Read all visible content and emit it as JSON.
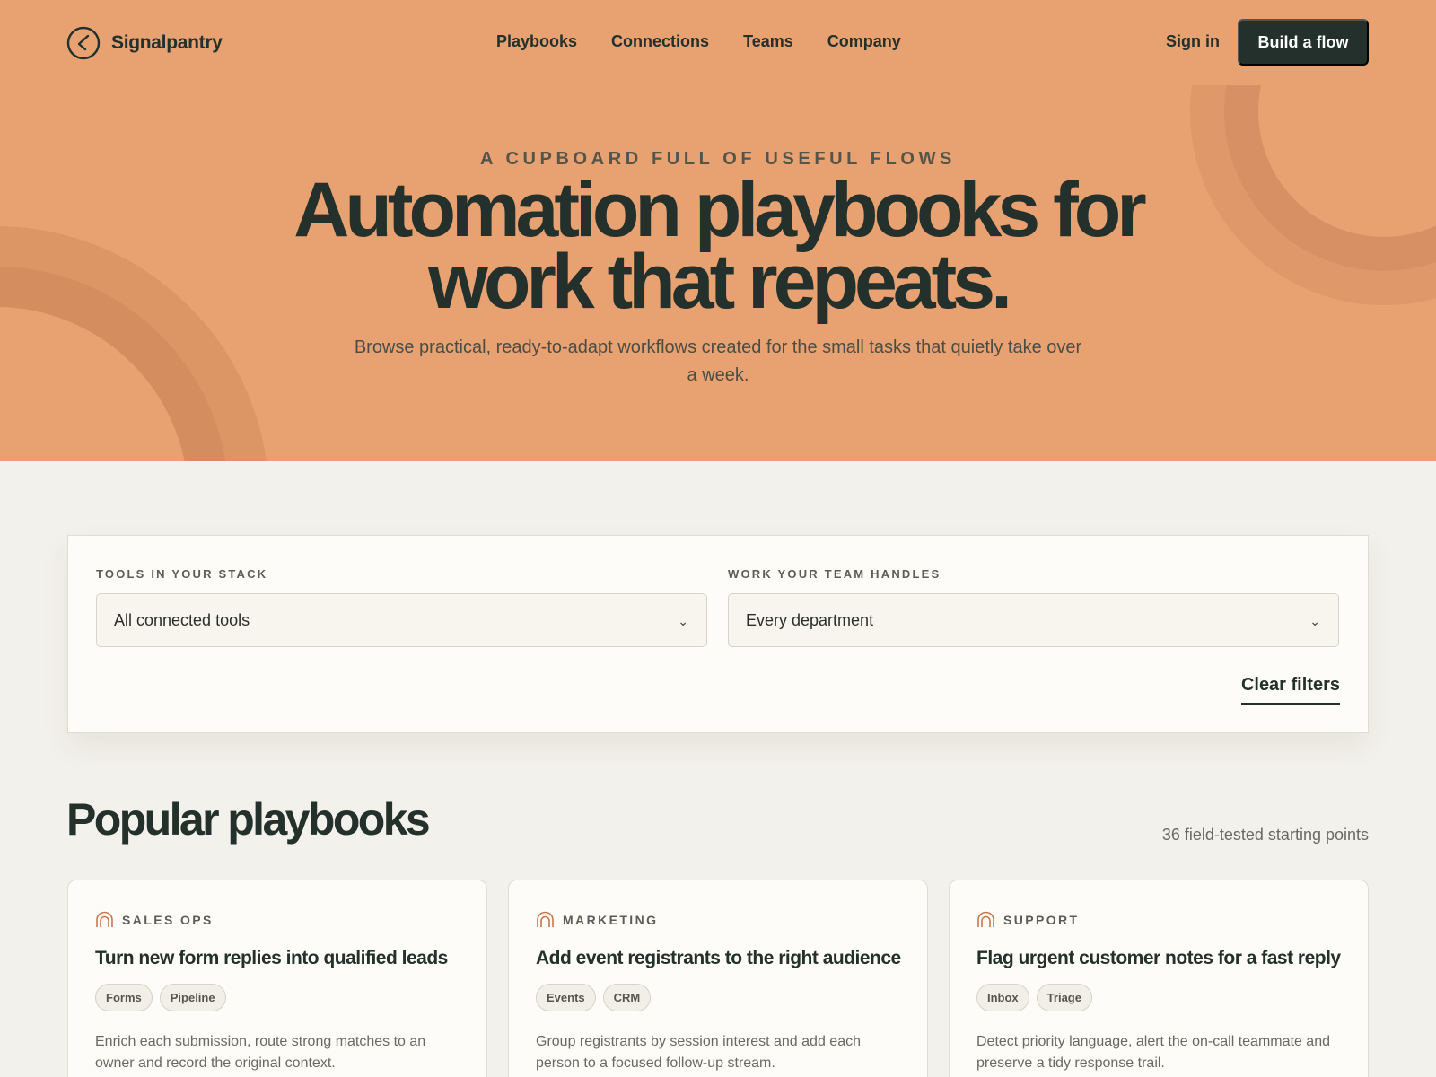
{
  "brand": {
    "name": "Signalpantry"
  },
  "nav": {
    "links": [
      {
        "label": "Playbooks"
      },
      {
        "label": "Connections"
      },
      {
        "label": "Teams"
      },
      {
        "label": "Company"
      }
    ],
    "sign_in": "Sign in",
    "cta": "Build a flow"
  },
  "hero": {
    "eyebrow": "A CUPBOARD FULL OF USEFUL FLOWS",
    "headline_line1": "Automation playbooks for",
    "headline_line2": "work that repeats.",
    "subline": "Browse practical, ready-to-adapt workflows created for the small tasks that quietly take over a week."
  },
  "filters": {
    "tools": {
      "label": "TOOLS IN YOUR STACK",
      "value": "All connected tools"
    },
    "department": {
      "label": "WORK YOUR TEAM HANDLES",
      "value": "Every department"
    },
    "clear": "Clear filters"
  },
  "section": {
    "title": "Popular playbooks",
    "count": "36 field-tested starting points"
  },
  "cards": [
    {
      "category": "SALES OPS",
      "title": "Turn new form replies into qualified leads",
      "tags": [
        "Forms",
        "Pipeline"
      ],
      "description": "Enrich each submission, route strong matches to an owner and record the original context."
    },
    {
      "category": "MARKETING",
      "title": "Add event registrants to the right audience",
      "tags": [
        "Events",
        "CRM"
      ],
      "description": "Group registrants by session interest and add each person to a focused follow-up stream."
    },
    {
      "category": "SUPPORT",
      "title": "Flag urgent customer notes for a fast reply",
      "tags": [
        "Inbox",
        "Triage"
      ],
      "description": "Detect priority language, alert the on-call teammate and preserve a tidy response trail."
    }
  ],
  "colors": {
    "hero_background": "#e8a171",
    "ink": "#24302b",
    "page_background": "#f3f1eb",
    "card_background": "#fdfcf8",
    "accent_icon": "#c9774d"
  },
  "icons": {
    "logo": "back-arrow-circle-icon",
    "select_chevron": "chevron-down-icon",
    "card_category": "arch-icon"
  }
}
